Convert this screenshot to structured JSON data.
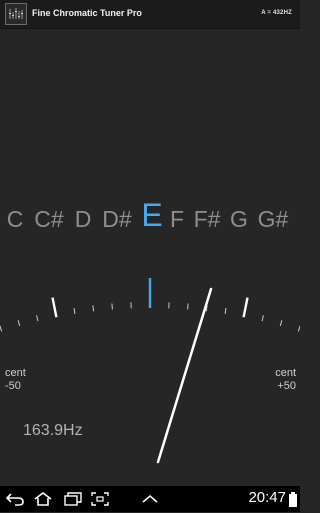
{
  "app": {
    "title": "Fine Chromatic Tuner Pro",
    "pitch_reference": "A = 432HZ",
    "icon": "tuner-app-icon"
  },
  "notes": {
    "items": [
      "C",
      "C#",
      "D",
      "D#",
      "E",
      "F",
      "F#",
      "G",
      "G#"
    ],
    "active": "E",
    "active_color": "#45aaf0",
    "inactive_color": "#8e8e8e"
  },
  "meter": {
    "left_label_unit": "cent",
    "left_label_value": "-50",
    "right_label_unit": "cent",
    "right_label_value": "+50",
    "needle_cents": 24,
    "min_cents": -50,
    "max_cents": 50,
    "center_marker_color": "#45aaf0"
  },
  "frequency": {
    "text": "163.9Hz"
  },
  "status_bar": {
    "time": "20:47",
    "icons": [
      "back-icon",
      "home-icon",
      "recent-apps-icon",
      "screenshot-icon",
      "menu-up-icon",
      "battery-icon"
    ]
  }
}
